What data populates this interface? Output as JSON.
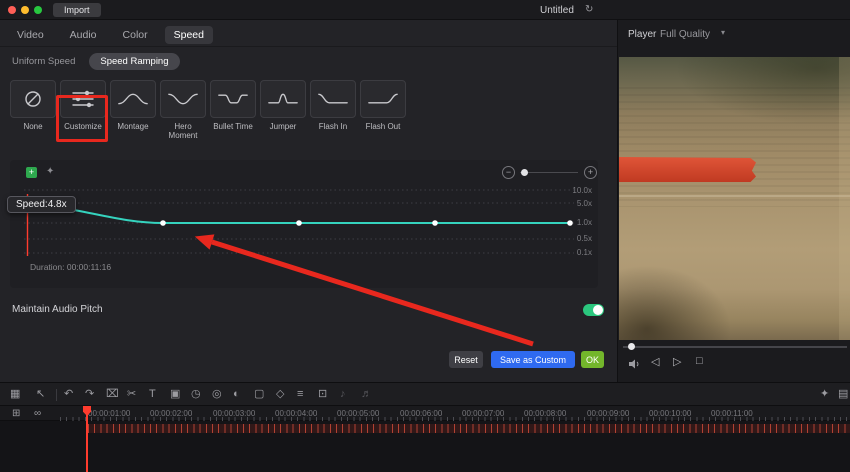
{
  "titlebar": {
    "import_label": "Import",
    "title": "Untitled",
    "sync_glyph": "↻"
  },
  "tabs": [
    {
      "label": "Video",
      "active": false
    },
    {
      "label": "Audio",
      "active": false
    },
    {
      "label": "Color",
      "active": false
    },
    {
      "label": "Speed",
      "active": true
    }
  ],
  "speed_modes": [
    {
      "label": "Uniform Speed",
      "active": false
    },
    {
      "label": "Speed Ramping",
      "active": true
    }
  ],
  "presets": [
    {
      "label": "None"
    },
    {
      "label": "Customize",
      "selected": true
    },
    {
      "label": "Montage"
    },
    {
      "label": "Hero Moment"
    },
    {
      "label": "Bullet Time"
    },
    {
      "label": "Jumper"
    },
    {
      "label": "Flash In"
    },
    {
      "label": "Flash Out"
    }
  ],
  "curve_editor": {
    "tooltip": "Speed:4.8x",
    "duration_label": "Duration: 00:00:11:16",
    "y_axis_labels": [
      "10.0x",
      "5.0x",
      "1.0x",
      "0.5x",
      "0.1x"
    ],
    "header_icons": [
      {
        "name": "add-point-icon",
        "glyph": "+"
      },
      {
        "name": "star-icon",
        "glyph": "✦"
      }
    ],
    "zoom": {
      "minus": "−",
      "plus": "+"
    },
    "curve_points": [
      {
        "position": 0.0,
        "speed": 4.8
      },
      {
        "position": 0.25,
        "speed": 1.0
      },
      {
        "position": 0.5,
        "speed": 1.0
      },
      {
        "position": 0.75,
        "speed": 1.0
      },
      {
        "position": 1.0,
        "speed": 1.0
      }
    ]
  },
  "audio_pitch": {
    "label": "Maintain Audio Pitch",
    "enabled": true
  },
  "footer_buttons": {
    "reset": "Reset",
    "save_as_custom": "Save as Custom",
    "ok": "OK"
  },
  "player": {
    "label": "Player",
    "quality": "Full Quality",
    "chevron": "▾"
  },
  "transport": [
    {
      "name": "frame-back-button",
      "glyph": "◁"
    },
    {
      "name": "play-button",
      "glyph": "▷"
    },
    {
      "name": "stop-button",
      "glyph": "□"
    }
  ],
  "toolbar_icons": [
    {
      "name": "media-grid-icon",
      "glyph": "▦"
    },
    {
      "name": "select-tool-icon",
      "glyph": "↖"
    },
    {
      "name": "undo-icon",
      "glyph": "↶"
    },
    {
      "name": "redo-icon",
      "glyph": "↷"
    },
    {
      "name": "delete-icon",
      "glyph": "⌧"
    },
    {
      "name": "split-icon",
      "glyph": "✂"
    },
    {
      "name": "text-tool-icon",
      "glyph": "T"
    },
    {
      "name": "crop-icon",
      "glyph": "▣"
    },
    {
      "name": "speed-icon",
      "glyph": "◷"
    },
    {
      "name": "snapshot-icon",
      "glyph": "◎"
    },
    {
      "name": "color-icon",
      "glyph": "◐"
    },
    {
      "name": "mask-icon",
      "glyph": "▢"
    },
    {
      "name": "keyframe-icon",
      "glyph": "◇"
    },
    {
      "name": "adjust-icon",
      "glyph": "≡"
    },
    {
      "name": "motion-track-icon",
      "glyph": "⊡"
    },
    {
      "name": "mute-icon",
      "glyph": "♪"
    },
    {
      "name": "detach-audio-icon",
      "glyph": "♬"
    }
  ],
  "toolbar_right_icons": [
    {
      "name": "ai-tools-icon",
      "glyph": "✦"
    },
    {
      "name": "panel-layout-icon",
      "glyph": "▤"
    }
  ],
  "timeline": {
    "icons": [
      {
        "name": "media-stack-icon",
        "glyph": "⊞"
      },
      {
        "name": "link-clips-icon",
        "glyph": "∞"
      }
    ],
    "timecodes": [
      "00:00:01:00",
      "00:00:02:00",
      "00:00:03:00",
      "00:00:04:00",
      "00:00:05:00",
      "00:00:06:00",
      "00:00:07:00",
      "00:00:08:00",
      "00:00:09:00",
      "00:00:10:00",
      "00:00:11:00"
    ]
  },
  "colors": {
    "accent_teal": "#35d3be",
    "annotation_red": "#e8281e",
    "primary_blue": "#2f6af0",
    "confirm_green": "#73b62b",
    "toggle_green": "#2bc77e",
    "playhead_red": "#ff3c2e"
  }
}
